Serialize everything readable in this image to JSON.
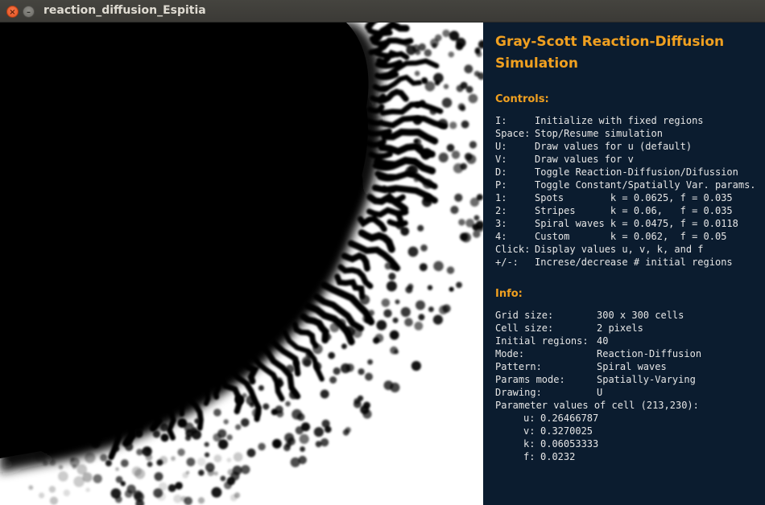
{
  "window": {
    "title": "reaction_diffusion_Espitia",
    "close_glyph": "×",
    "minimize_glyph": "–"
  },
  "canvas": {
    "background_color": "#ffffff",
    "pattern_color": "#000000",
    "description": "Simulation canvas showing Spiral waves pattern, drawing u"
  },
  "panel": {
    "title": "Gray-Scott Reaction-Diffusion Simulation",
    "title_color": "#f0a020",
    "background_color": "#0b1c2f",
    "controls_heading": "Controls:",
    "controls": [
      {
        "key": "I:",
        "desc": "Initialize with fixed regions"
      },
      {
        "key": "Space:",
        "desc": "Stop/Resume simulation"
      },
      {
        "key": "U:",
        "desc": "Draw values for u (default)"
      },
      {
        "key": "V:",
        "desc": "Draw values for v"
      },
      {
        "key": "D:",
        "desc": "Toggle Reaction-Diffusion/Difussion"
      },
      {
        "key": "P:",
        "desc": "Toggle Constant/Spatially Var. params."
      },
      {
        "key": "1:",
        "desc": "Spots        k = 0.0625, f = 0.035"
      },
      {
        "key": "2:",
        "desc": "Stripes      k = 0.06,   f = 0.035"
      },
      {
        "key": "3:",
        "desc": "Spiral waves k = 0.0475, f = 0.0118"
      },
      {
        "key": "4:",
        "desc": "Custom       k = 0.062,  f = 0.05"
      },
      {
        "key": "Click:",
        "desc": "Display values u, v, k, and f"
      },
      {
        "key": "+/-:",
        "desc": "Increse/decrease # initial regions"
      }
    ],
    "info_heading": "Info:",
    "info": [
      {
        "key": "Grid size:",
        "value": "300 x 300 cells"
      },
      {
        "key": "Cell size:",
        "value": "2 pixels"
      },
      {
        "key": "Initial regions:",
        "value": "40"
      },
      {
        "key": "Mode:",
        "value": "Reaction-Diffusion"
      },
      {
        "key": "Pattern:",
        "value": "Spiral waves"
      },
      {
        "key": "Params mode:",
        "value": "Spatially-Varying"
      },
      {
        "key": "Drawing:",
        "value": "U"
      }
    ],
    "cell_params_label": "Parameter values of cell (213,230):",
    "cell_params": [
      {
        "key": "u:",
        "value": "0.26466787"
      },
      {
        "key": "v:",
        "value": "0.3270025"
      },
      {
        "key": "k:",
        "value": "0.06053333"
      },
      {
        "key": "f:",
        "value": "0.0232"
      }
    ]
  }
}
